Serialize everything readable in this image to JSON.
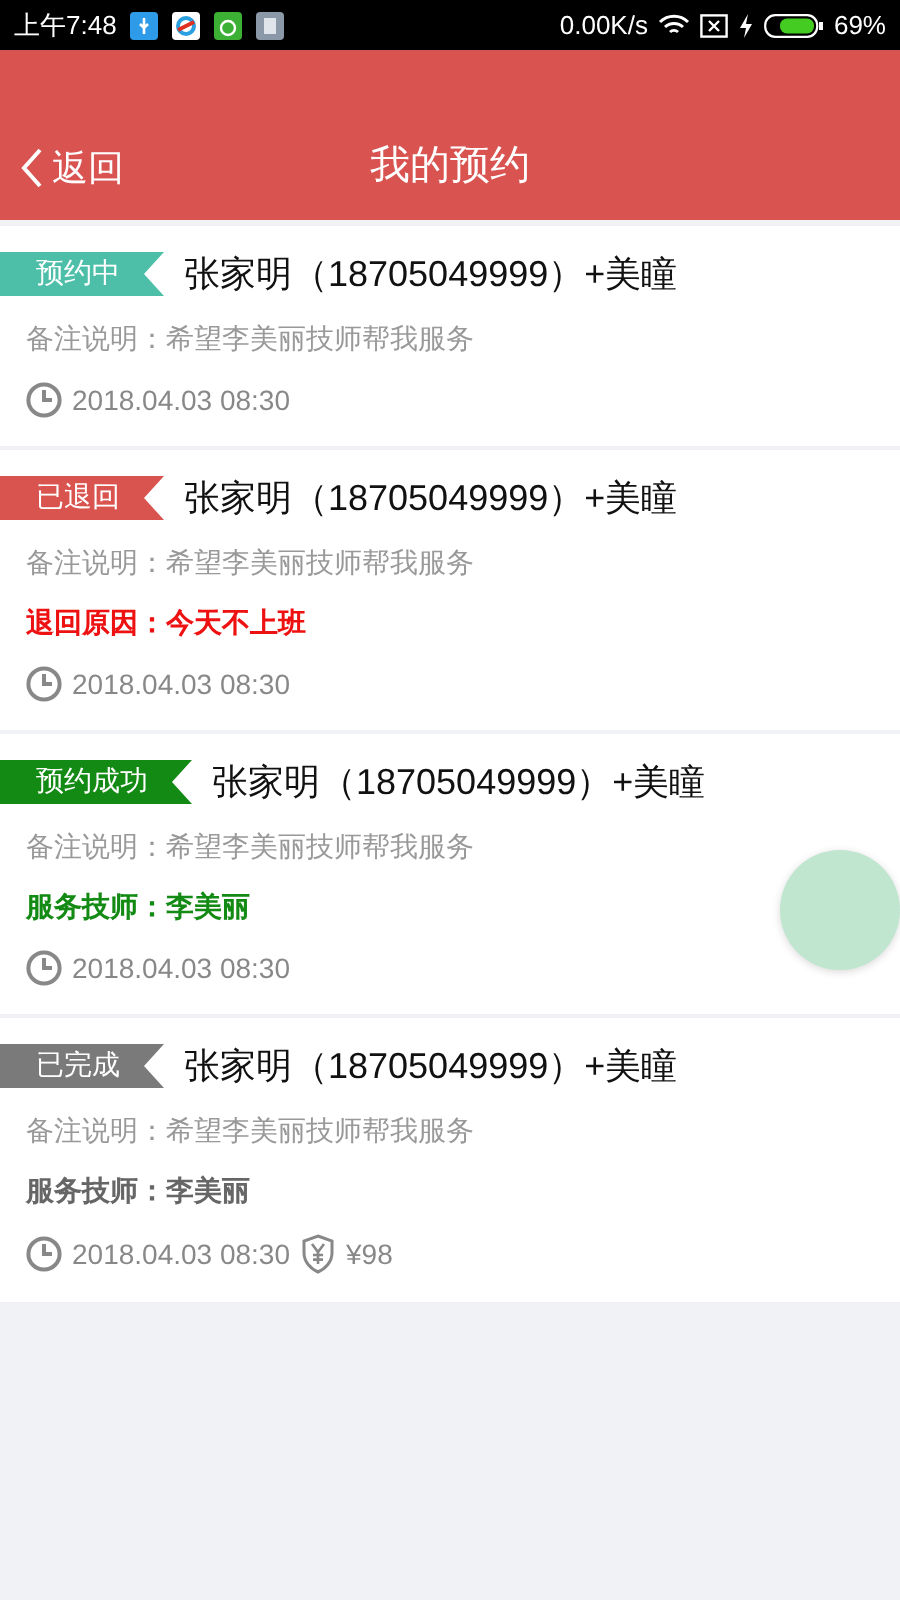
{
  "status_bar": {
    "time": "上午7:48",
    "speed": "0.00K/s",
    "battery": "69%"
  },
  "header": {
    "back": "返回",
    "title": "我的预约"
  },
  "cards": [
    {
      "tag": "预约中",
      "color": "#4dbfa8",
      "name": "张家明（18705049999）+美瞳",
      "note": "备注说明：希望李美丽技师帮我服务",
      "time": "2018.04.03 08:30"
    },
    {
      "tag": "已退回",
      "color": "#d9534f",
      "name": "张家明（18705049999）+美瞳",
      "note": "备注说明：希望李美丽技师帮我服务",
      "extra": {
        "text": "退回原因：今天不上班",
        "color": "#ee1111"
      },
      "time": "2018.04.03 08:30"
    },
    {
      "tag": "预约成功",
      "color": "#138a13",
      "name": "张家明（18705049999）+美瞳",
      "note": "备注说明：希望李美丽技师帮我服务",
      "extra": {
        "text": "服务技师：李美丽",
        "color": "#138a13"
      },
      "time": "2018.04.03 08:30"
    },
    {
      "tag": "已完成",
      "color": "#7a7a7a",
      "name": "张家明（18705049999）+美瞳",
      "note": "备注说明：希望李美丽技师帮我服务",
      "extra": {
        "text": "服务技师：李美丽",
        "color": "#666666"
      },
      "time": "2018.04.03 08:30",
      "price": "¥98"
    }
  ]
}
